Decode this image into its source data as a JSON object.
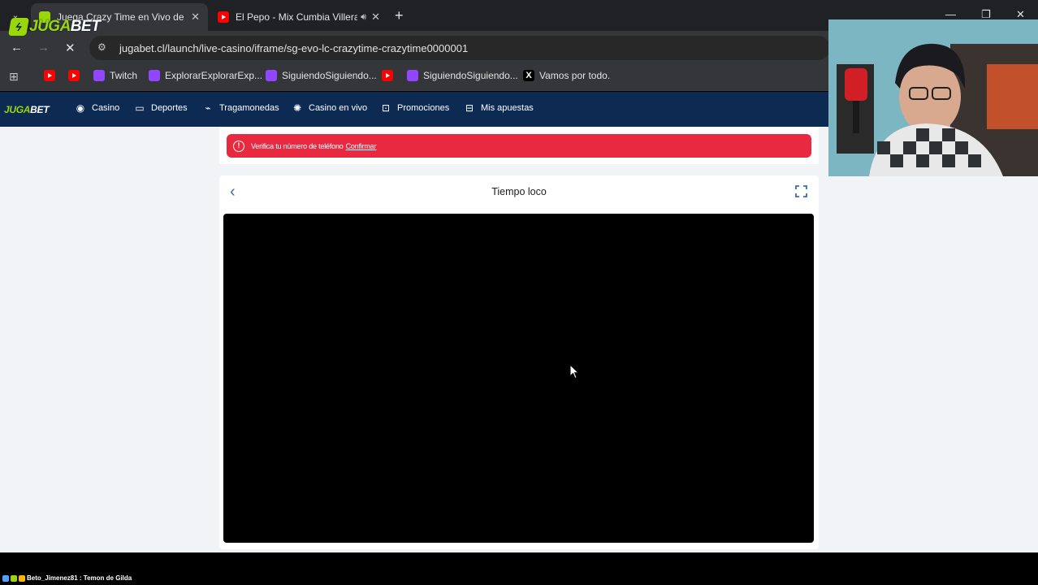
{
  "browser": {
    "tabs": [
      {
        "title": "Juega Crazy Time en Vivo de Ev",
        "active": true
      },
      {
        "title": "El Pepo - Mix Cumbia Villera",
        "active": false
      }
    ],
    "url": "jugabet.cl/launch/live-casino/iframe/sg-evo-lc-crazytime-crazytime0000001",
    "bookmarks": [
      {
        "label": "",
        "icon": "youtube-icon"
      },
      {
        "label": "",
        "icon": "youtube-icon"
      },
      {
        "label": "Twitch",
        "icon": "twitch-icon"
      },
      {
        "label": "ExplorarExplorarExp...",
        "icon": "twitch-icon"
      },
      {
        "label": "SiguiendoSiguiendo...",
        "icon": "twitch-icon"
      },
      {
        "label": "",
        "icon": "youtube-icon"
      },
      {
        "label": "SiguiendoSiguiendo...",
        "icon": "twitch-icon"
      },
      {
        "label": "Vamos por todo.",
        "icon": "x-icon"
      }
    ]
  },
  "overlay_logo": {
    "prefix": "JUGA",
    "suffix": "BET"
  },
  "site": {
    "logo": {
      "prefix": "JUGA",
      "suffix": "BET"
    },
    "nav": [
      {
        "label": "Casino",
        "icon": "casino-chip-icon"
      },
      {
        "label": "Deportes",
        "icon": "scoreboard-icon"
      },
      {
        "label": "Tragamonedas",
        "icon": "slot-icon"
      },
      {
        "label": "Casino en vivo",
        "icon": "live-chip-icon"
      },
      {
        "label": "Promociones",
        "icon": "gift-icon"
      },
      {
        "label": "Mis apuestas",
        "icon": "ticket-icon"
      }
    ],
    "alert": {
      "text": "Verifica tu número de teléfono",
      "link": "Confirmar"
    },
    "game": {
      "title": "Tiempo loco"
    }
  },
  "stream": {
    "ticker": "Beto_Jimenez81 : Temon de Gilda"
  },
  "colors": {
    "tabbar": "#202124",
    "toolbar": "#35363a",
    "site_nav": "#0d2a52",
    "brand_green": "#9ad70a",
    "alert_red": "#e8293f",
    "page_bg": "#f1f3f7"
  }
}
